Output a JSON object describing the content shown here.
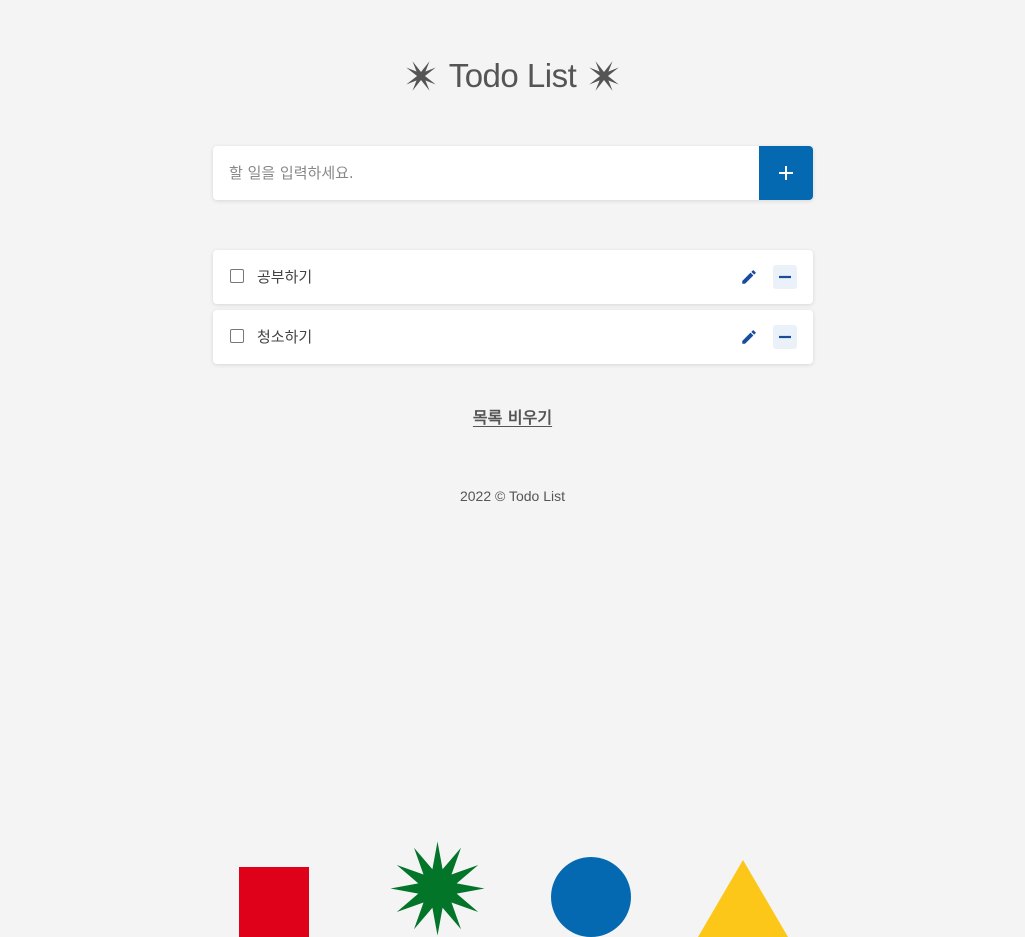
{
  "header": {
    "title": "Todo List",
    "star_icon": "asterisk-star-icon"
  },
  "input": {
    "placeholder": "할 일을 입력하세요.",
    "value": "",
    "add_icon": "plus-icon"
  },
  "todos": [
    {
      "label": "공부하기",
      "checked": false,
      "edit_icon": "pencil-icon",
      "delete_icon": "minus-icon"
    },
    {
      "label": "청소하기",
      "checked": false,
      "edit_icon": "pencil-icon",
      "delete_icon": "minus-icon"
    }
  ],
  "actions": {
    "clear_label": "목록 비우기"
  },
  "footer": {
    "text": "2022 © Todo List"
  },
  "decorations": [
    {
      "name": "red-square",
      "color": "#df0019"
    },
    {
      "name": "green-starburst",
      "color": "#037529"
    },
    {
      "name": "blue-circle",
      "color": "#0569b1"
    },
    {
      "name": "yellow-triangle",
      "color": "#fcc718"
    }
  ],
  "colors": {
    "accent": "#0569b1",
    "background": "#f4f4f4",
    "icon": "#1a4c9c"
  }
}
